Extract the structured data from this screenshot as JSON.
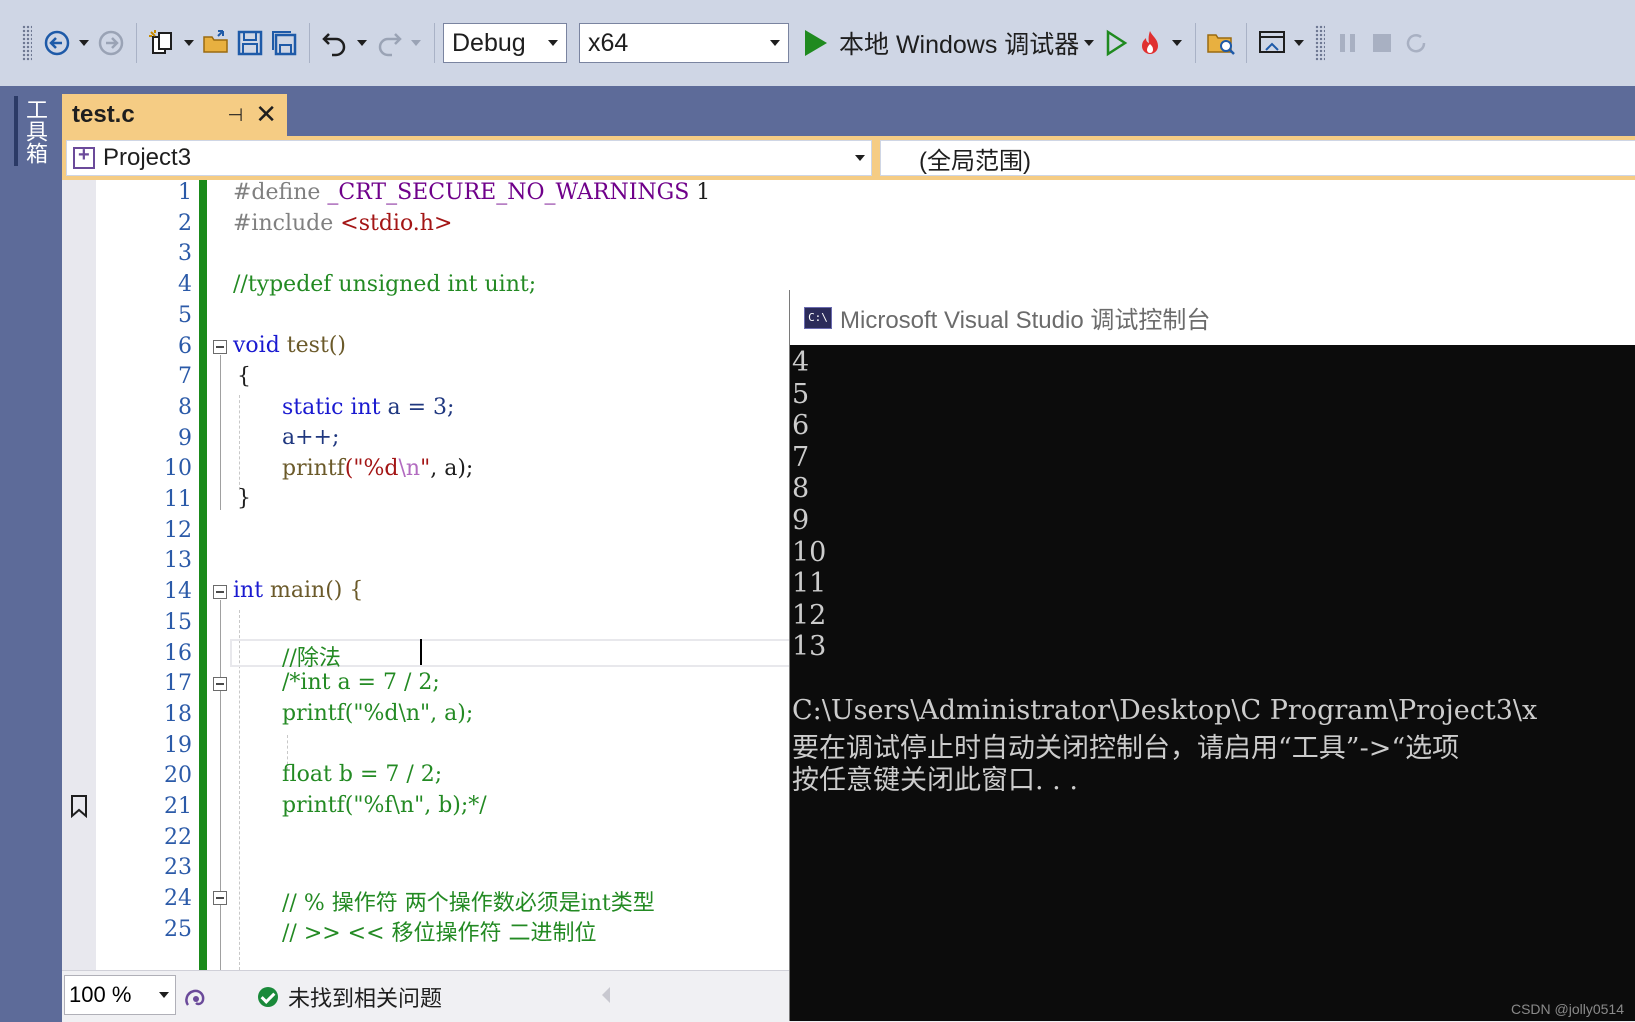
{
  "toolbar": {
    "config": "Debug",
    "platform": "x64",
    "run_label": "本地 Windows 调试器",
    "colors": {
      "background": "#cfd6e5",
      "run": "#1f8a1f"
    }
  },
  "toolbox": {
    "label": "工具箱"
  },
  "tab": {
    "title": "test.c"
  },
  "nav": {
    "project": "Project3",
    "scope": "(全局范围)"
  },
  "editor": {
    "line_numbers": [
      "1",
      "2",
      "3",
      "4",
      "5",
      "6",
      "7",
      "8",
      "9",
      "10",
      "11",
      "12",
      "13",
      "14",
      "15",
      "16",
      "17",
      "18",
      "19",
      "20",
      "21",
      "22",
      "23",
      "24",
      "25"
    ],
    "lines": [
      [
        "#define ",
        "_CRT_SECURE_NO_WARNINGS",
        " 1"
      ],
      [
        "#include ",
        "<stdio.h>"
      ],
      [],
      [
        "//typedef unsigned int uint;"
      ],
      [],
      [
        "void",
        " test()"
      ],
      [
        "{"
      ],
      [
        "static",
        " ",
        "int",
        " a = 3;"
      ],
      [
        "a++;"
      ],
      [
        "printf",
        "(\"",
        "%d",
        "\\n",
        "\"",
        ", a);"
      ],
      [
        "}"
      ],
      [],
      [],
      [
        "int",
        " main() {"
      ],
      [],
      [
        "//除法"
      ],
      [
        "/*int a = 7 / 2;"
      ],
      [
        "printf(\"%d\\n\", a);"
      ],
      [],
      [
        "float b = 7 / 2;"
      ],
      [
        "printf(\"%f\\n\", b);*/"
      ],
      [],
      [],
      [
        "// % 操作符 两个操作数必须是int类型"
      ],
      [
        "// >> << 移位操作符 二进制位"
      ]
    ]
  },
  "status": {
    "zoom": "100 %",
    "issues": "未找到相关问题"
  },
  "console": {
    "title": "Microsoft Visual Studio 调试控制台",
    "icon_text": "C:\\",
    "output": [
      "4",
      "5",
      "6",
      "7",
      "8",
      "9",
      "10",
      "11",
      "12",
      "13",
      "",
      "C:\\Users\\Administrator\\Desktop\\C Program\\Project3\\x",
      "要在调试停止时自动关闭控制台，请启用“工具”->“选项",
      "按任意键关闭此窗口. . ."
    ]
  },
  "watermark": "CSDN @jolly0514"
}
